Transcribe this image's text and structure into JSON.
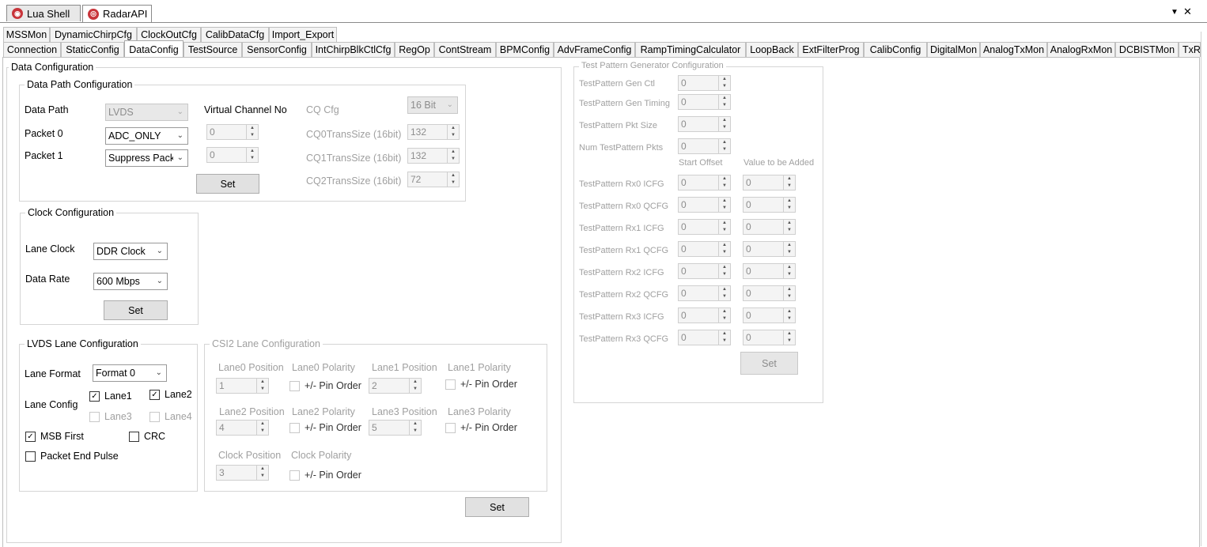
{
  "doc_tabs": [
    {
      "label": "Lua Shell",
      "icon": "lua-icon"
    },
    {
      "label": "RadarAPI",
      "icon": "radar-icon"
    }
  ],
  "window": {
    "dropdown_glyph": "▼",
    "close_glyph": "✕"
  },
  "tabs_row1": [
    "MSSMon",
    "DynamicChirpCfg",
    "ClockOutCfg",
    "CalibDataCfg",
    "Import_Export"
  ],
  "tabs_row2": [
    "Connection",
    "StaticConfig",
    "DataConfig",
    "TestSource",
    "SensorConfig",
    "IntChirpBlkCtlCfg",
    "RegOp",
    "ContStream",
    "BPMConfig",
    "AdvFrameConfig",
    "RampTimingCalculator",
    "LoopBack",
    "ExtFilterProg",
    "CalibConfig",
    "DigitalMon",
    "AnalogTxMon",
    "AnalogRxMon",
    "DCBISTMon",
    "TxR"
  ],
  "data_config": {
    "title": "Data Configuration",
    "data_path": {
      "title": "Data Path Configuration",
      "data_path_label": "Data Path",
      "data_path_value": "LVDS",
      "packet0_label": "Packet 0",
      "packet0_value": "ADC_ONLY",
      "packet1_label": "Packet 1",
      "packet1_value": "Suppress Packet",
      "vc_label": "Virtual Channel No",
      "vc0_value": "0",
      "vc1_value": "0",
      "set_label": "Set",
      "cq_cfg_label": "CQ Cfg",
      "cq_cfg_value": "16 Bit",
      "cq0_label": "CQ0TransSize (16bit)",
      "cq0_value": "132",
      "cq1_label": "CQ1TransSize (16bit)",
      "cq1_value": "132",
      "cq2_label": "CQ2TransSize (16bit)",
      "cq2_value": "72"
    },
    "clock": {
      "title": "Clock Configuration",
      "lane_clock_label": "Lane Clock",
      "lane_clock_value": "DDR Clock",
      "data_rate_label": "Data Rate",
      "data_rate_value": "600 Mbps",
      "set_label": "Set"
    },
    "lvds": {
      "title": "LVDS Lane Configuration",
      "lane_format_label": "Lane Format",
      "lane_format_value": "Format 0",
      "lane_config_label": "Lane Config",
      "lane1": "Lane1",
      "lane2": "Lane2",
      "lane3": "Lane3",
      "lane4": "Lane4",
      "msb_first": "MSB First",
      "crc": "CRC",
      "packet_end_pulse": "Packet End Pulse"
    },
    "csi2": {
      "title": "CSI2 Lane Configuration",
      "lane0_pos_label": "Lane0 Position",
      "lane0_pos_value": "1",
      "lane0_pol_label": "Lane0 Polarity",
      "lane1_pos_label": "Lane1 Position",
      "lane1_pos_value": "2",
      "lane1_pol_label": "Lane1 Polarity",
      "lane2_pos_label": "Lane2 Position",
      "lane2_pos_value": "4",
      "lane2_pol_label": "Lane2 Polarity",
      "lane3_pos_label": "Lane3 Position",
      "lane3_pos_value": "5",
      "lane3_pol_label": "Lane3 Polarity",
      "clock_pos_label": "Clock Position",
      "clock_pos_value": "3",
      "clock_pol_label": "Clock Polarity",
      "pin_order": "+/- Pin Order",
      "set_label": "Set"
    }
  },
  "test_pattern": {
    "title": "Test Pattern Generator Configuration",
    "gen_ctl_label": "TestPattern Gen Ctl",
    "gen_ctl_value": "0",
    "gen_timing_label": "TestPattern Gen Timing",
    "gen_timing_value": "0",
    "pkt_size_label": "TestPattern Pkt Size",
    "pkt_size_value": "0",
    "num_pkts_label": "Num TestPattern Pkts",
    "num_pkts_value": "0",
    "col_start_offset": "Start Offset",
    "col_value_added": "Value to be Added",
    "rows": [
      {
        "label": "TestPattern Rx0 ICFG",
        "offset": "0",
        "add": "0"
      },
      {
        "label": "TestPattern Rx0 QCFG",
        "offset": "0",
        "add": "0"
      },
      {
        "label": "TestPattern Rx1 ICFG",
        "offset": "0",
        "add": "0"
      },
      {
        "label": "TestPattern Rx1 QCFG",
        "offset": "0",
        "add": "0"
      },
      {
        "label": "TestPattern Rx2 ICFG",
        "offset": "0",
        "add": "0"
      },
      {
        "label": "TestPattern Rx2 QCFG",
        "offset": "0",
        "add": "0"
      },
      {
        "label": "TestPattern Rx3 ICFG",
        "offset": "0",
        "add": "0"
      },
      {
        "label": "TestPattern Rx3 QCFG",
        "offset": "0",
        "add": "0"
      }
    ],
    "set_label": "Set"
  }
}
